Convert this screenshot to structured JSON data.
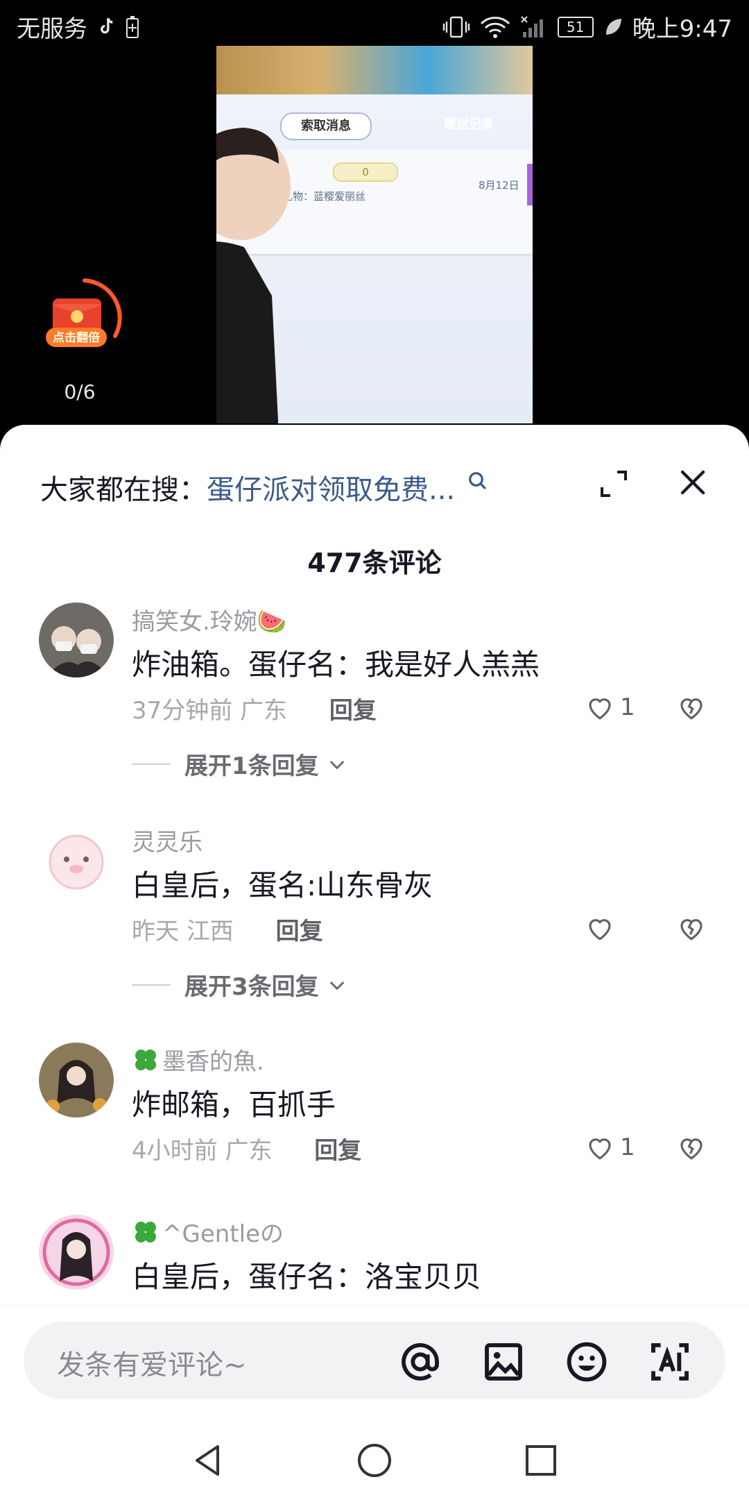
{
  "status_bar": {
    "carrier": "无服务",
    "battery_level": "51",
    "time": "晚上9:47"
  },
  "video": {
    "tab_active": "索取消息",
    "tab_inactive": "赠送记录",
    "coin_value": "0",
    "gift_text": "份礼物：蓝樱爱丽丝",
    "date": "8月12日"
  },
  "red_envelope": {
    "label": "点击翻倍",
    "progress": "0/6"
  },
  "header": {
    "search_prefix": "大家都在搜：",
    "search_query": "蛋仔派对领取免费..."
  },
  "comment_count": "477条评论",
  "comments": [
    {
      "username": "搞笑女.玲婉🍉",
      "text": "炸油箱。蛋仔名：我是好人羔羔",
      "time": "37分钟前",
      "location": "广东",
      "reply_label": "回复",
      "likes": "1",
      "expand_label": "展开1条回复"
    },
    {
      "username": "灵灵乐",
      "text": "白皇后，蛋名:山东骨灰",
      "time": "昨天",
      "location": "江西",
      "reply_label": "回复",
      "likes": "",
      "expand_label": "展开3条回复"
    },
    {
      "username": "墨香的魚.",
      "text": "炸邮箱，百抓手",
      "time": "4小时前",
      "location": "广东",
      "reply_label": "回复",
      "likes": "1",
      "expand_label": ""
    },
    {
      "username": "^Gentleの",
      "text": "白皇后，蛋仔名：洛宝贝贝",
      "time": "",
      "location": "",
      "reply_label": "",
      "likes": "",
      "expand_label": ""
    }
  ],
  "input": {
    "placeholder": "发条有爱评论~"
  },
  "colors": {
    "accent_link": "#3b5a8c",
    "envelope_red": "#e8412c",
    "clover_green": "#3aa83a"
  },
  "icons": [
    "search-icon",
    "expand-icon",
    "close-icon",
    "heart-icon",
    "broken-heart-icon",
    "chevron-down-icon",
    "at-icon",
    "image-icon",
    "emoji-icon",
    "ai-icon",
    "back-icon",
    "home-icon",
    "recents-icon"
  ]
}
